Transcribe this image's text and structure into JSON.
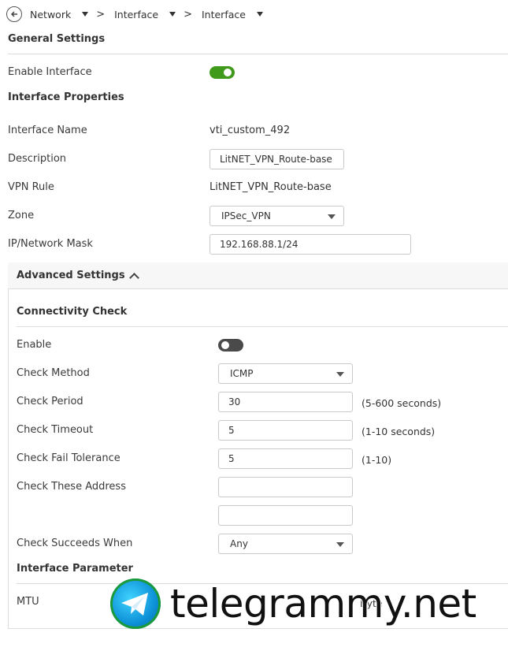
{
  "breadcrumb": {
    "items": [
      "Network",
      "Interface",
      "Interface"
    ],
    "separator": ">"
  },
  "general": {
    "title": "General Settings",
    "enable_label": "Enable Interface",
    "enable_state": "on"
  },
  "properties": {
    "title": "Interface Properties",
    "name_label": "Interface Name",
    "name_value": "vti_custom_492",
    "description_label": "Description",
    "description_value": "LitNET_VPN_Route-base",
    "vpn_rule_label": "VPN Rule",
    "vpn_rule_value": "LitNET_VPN_Route-base",
    "zone_label": "Zone",
    "zone_value": "IPSec_VPN",
    "ip_label": "IP/Network Mask",
    "ip_value": "192.168.88.1/24"
  },
  "advanced": {
    "title": "Advanced Settings",
    "connectivity": {
      "title": "Connectivity Check",
      "enable_label": "Enable",
      "enable_state": "off",
      "method_label": "Check Method",
      "method_value": "ICMP",
      "period_label": "Check Period",
      "period_value": "30",
      "period_hint": "(5-600 seconds)",
      "timeout_label": "Check Timeout",
      "timeout_value": "5",
      "timeout_hint": "(1-10 seconds)",
      "fail_label": "Check Fail Tolerance",
      "fail_value": "5",
      "fail_hint": "(1-10)",
      "address_label": "Check These Address",
      "address_1": "",
      "address_2": "",
      "succeeds_label": "Check Succeeds When",
      "succeeds_value": "Any"
    },
    "interface_param": {
      "title": "Interface Parameter",
      "mtu_label": "MTU",
      "mtu_partial": "Byte"
    }
  },
  "watermark": {
    "text": "telegrammy.net",
    "logo_icon": "telegram-logo-icon"
  },
  "colors": {
    "toggle_on": "#3f9a1c",
    "toggle_off": "#4a4a4a",
    "border": "#c9c9c9",
    "text": "#3a3a3a"
  }
}
